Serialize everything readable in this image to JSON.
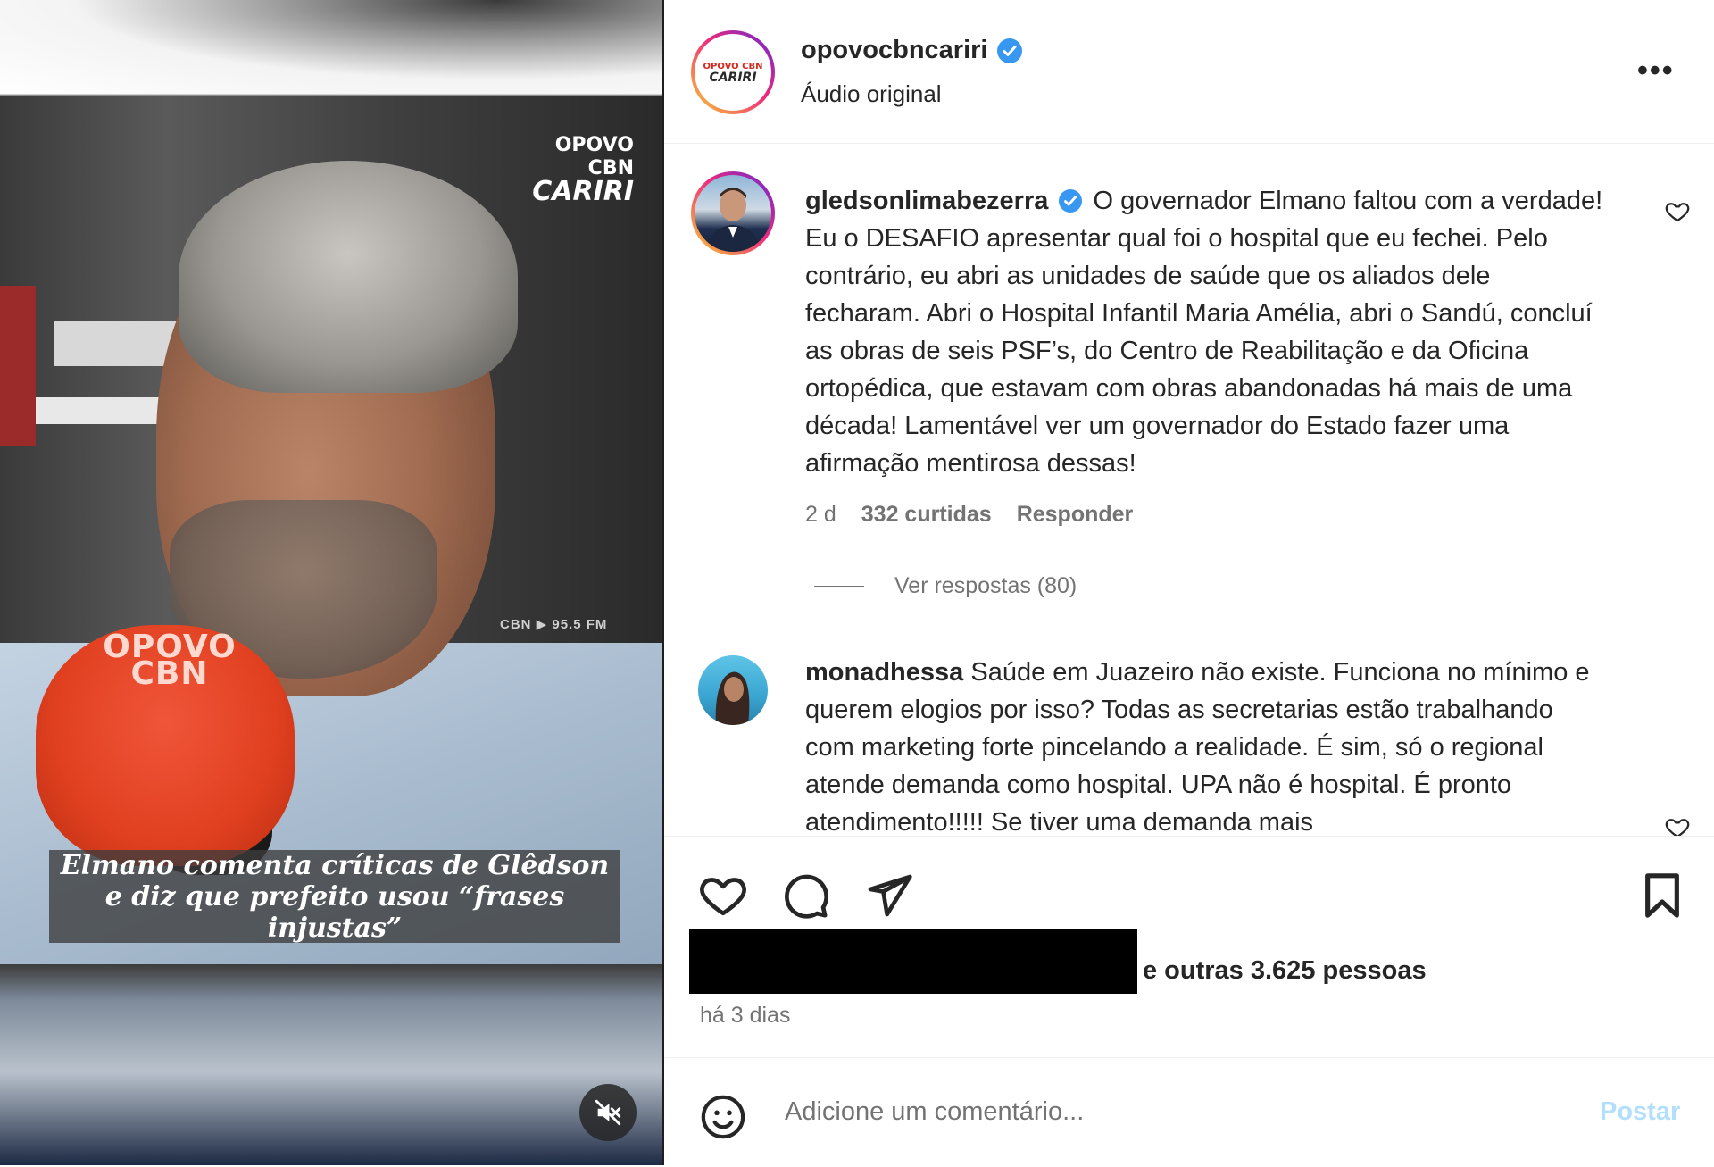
{
  "media": {
    "brand_line1": "OPOVO CBN",
    "brand_line2": "CARIRI",
    "mic_label": "OPOVO CBN",
    "radio_tag": "CBN ▶ 95.5 FM",
    "caption": "Elmano comenta críticas de Glêdson e diz que prefeito usou “frases injustas”"
  },
  "header": {
    "username": "opovocbncariri",
    "subtitle": "Áudio original",
    "logo_line1": "OPOVO CBN",
    "logo_line2": "CARIRI"
  },
  "comments": [
    {
      "username": "gledsonlimabezerra",
      "text": "O governador Elmano faltou com a verdade! Eu o DESAFIO apresentar qual foi o hospital que eu fechei. Pelo contrário, eu abri as unidades de saúde que os aliados dele fecharam. Abri o Hospital Infantil Maria Amélia, abri o Sandú, concluí as obras de seis PSF’s, do Centro de Reabilitação e da Oficina ortopédica, que estavam com obras abandonadas há mais de uma década! Lamentável ver um governador do Estado fazer uma afirmação mentirosa dessas!",
      "time": "2 d",
      "likes": "332 curtidas",
      "reply": "Responder",
      "view_replies": "Ver respostas (80)"
    },
    {
      "username": "monadhessa",
      "text": "Saúde em Juazeiro não existe. Funciona no mínimo e querem elogios por isso? Todas as secretarias estão trabalhando com marketing forte pincelando a realidade. É sim, só o regional atende demanda como hospital. UPA não é hospital. É pronto atendimento!!!!! Se tiver uma demanda mais"
    }
  ],
  "footer": {
    "likes_text": "e outras 3.625 pessoas",
    "time_ago": "há 3 dias",
    "comment_placeholder": "Adicione um comentário...",
    "post_label": "Postar"
  },
  "colors": {
    "verified": "#3897f0",
    "post_disabled": "#b2dffc",
    "muted_text": "#737373"
  }
}
